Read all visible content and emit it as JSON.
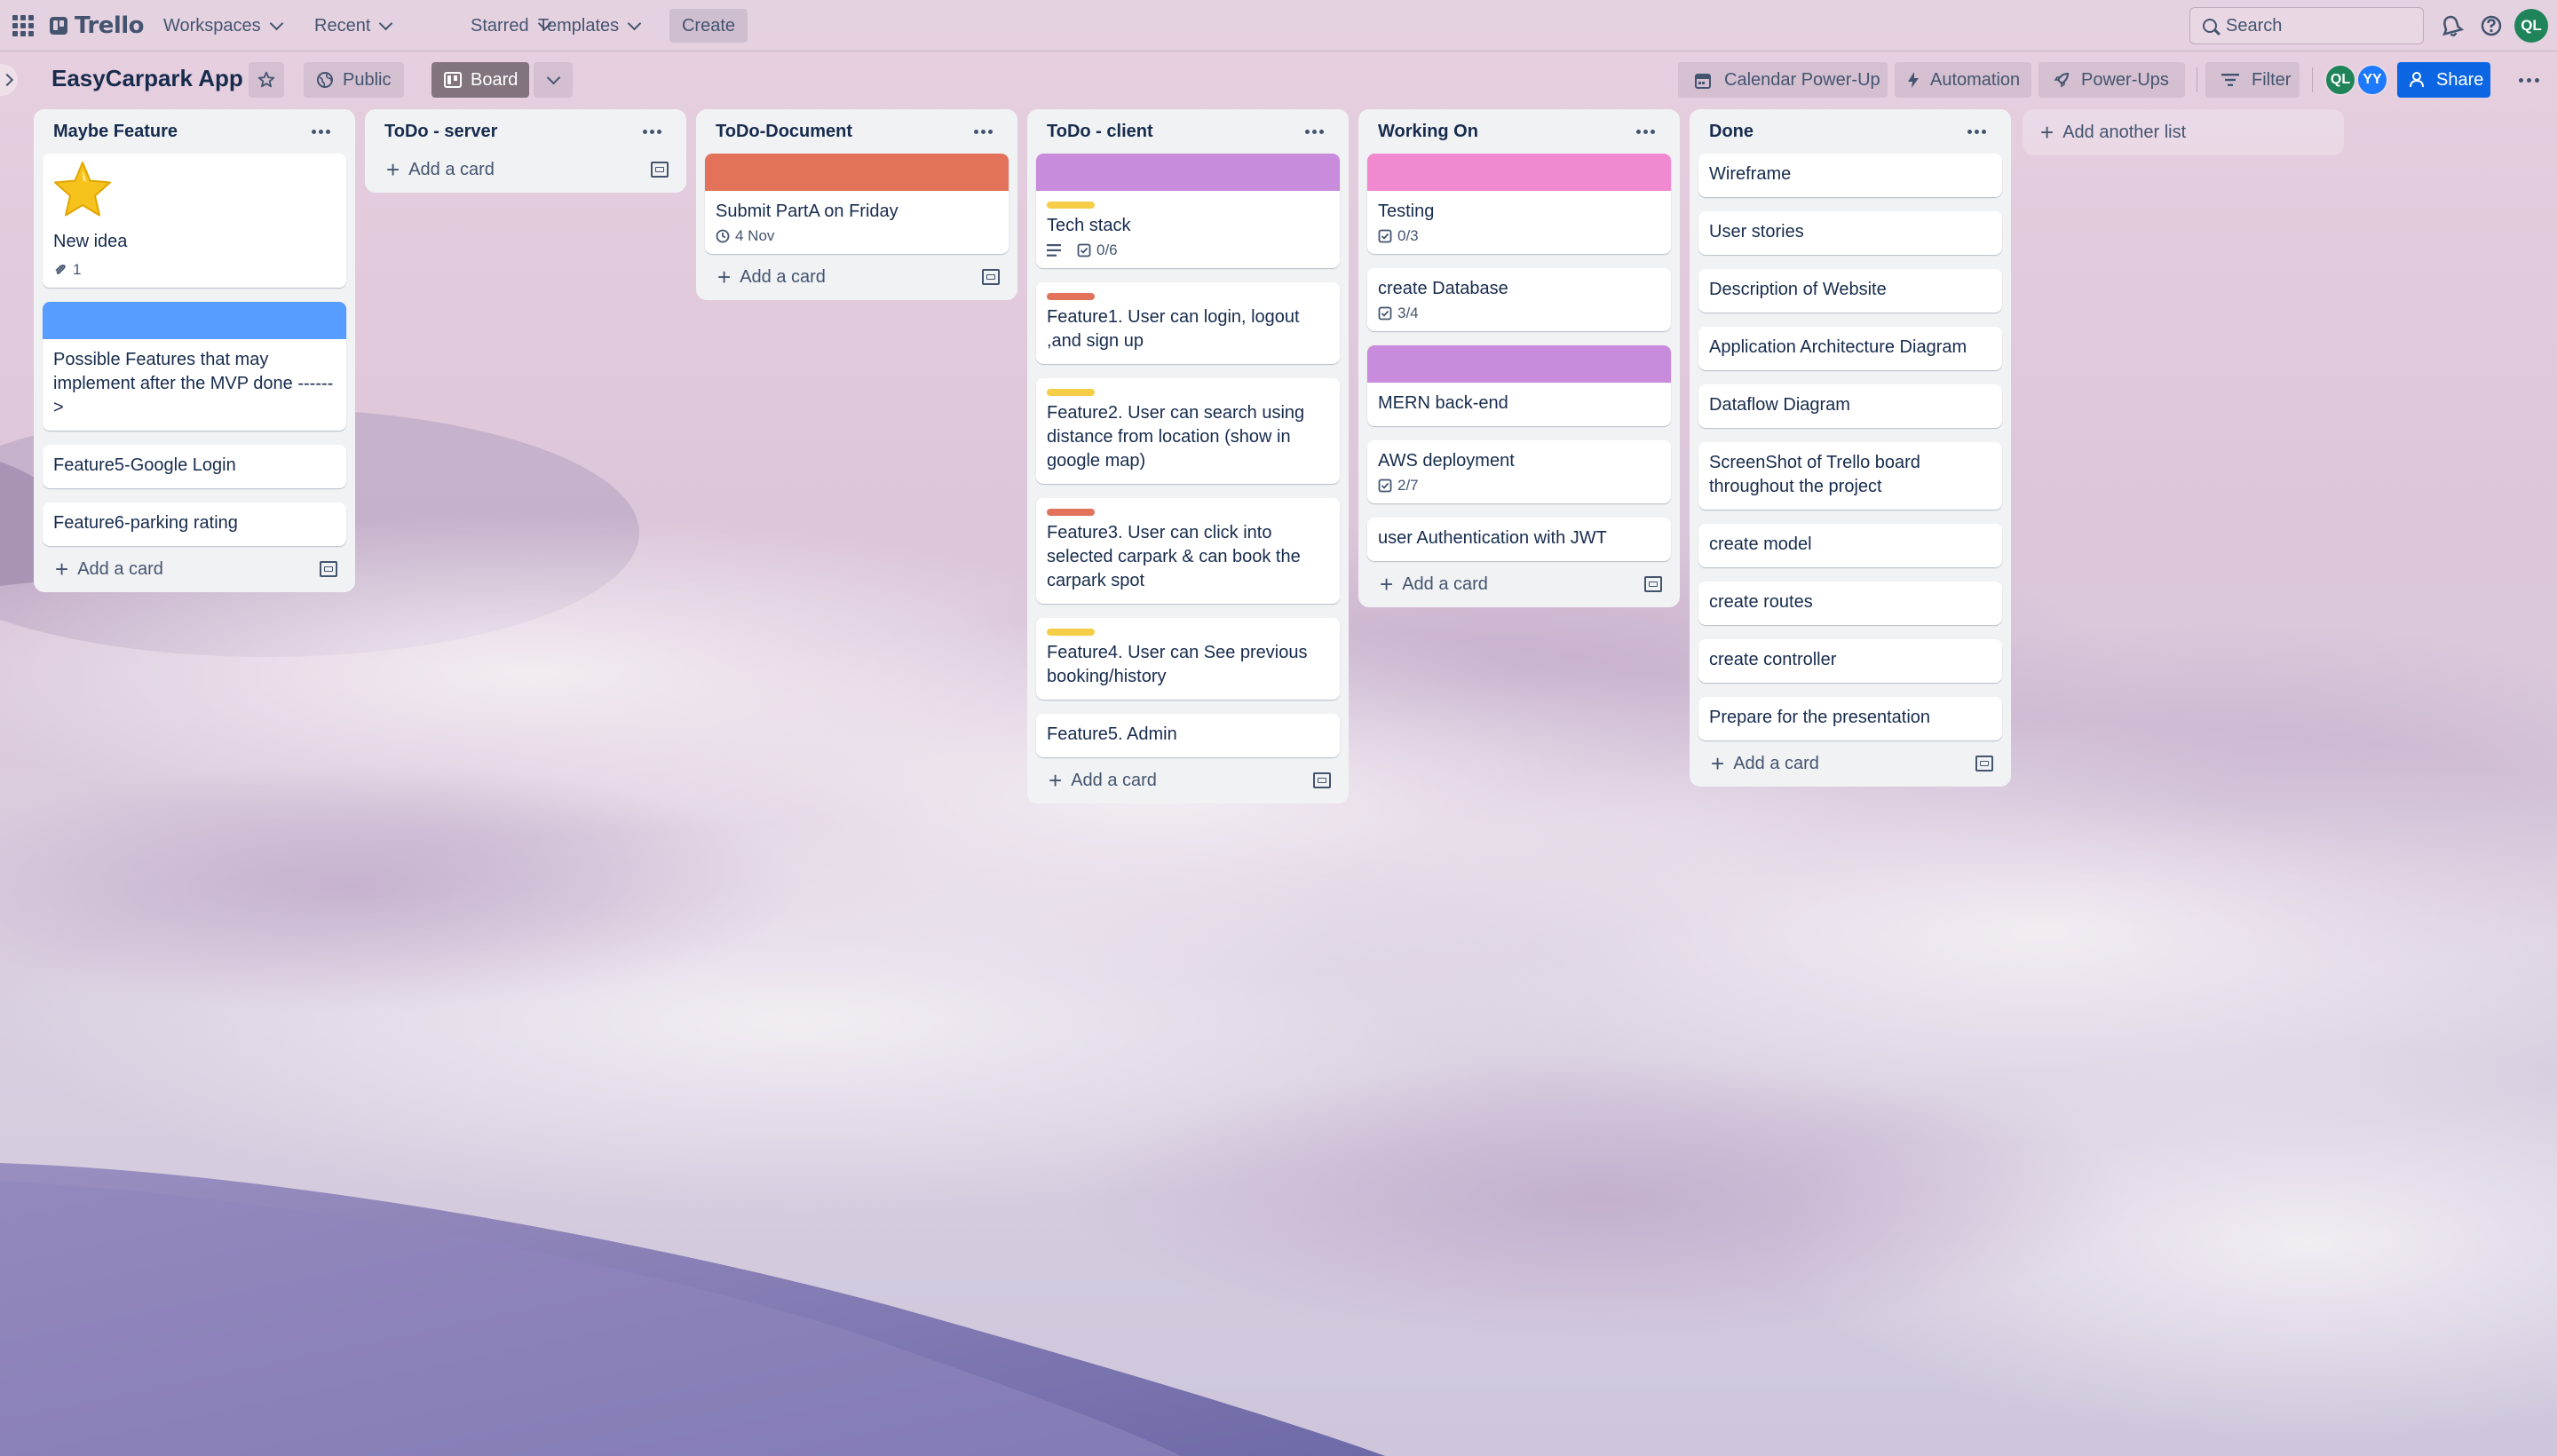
{
  "topbar": {
    "logo": "Trello",
    "nav": [
      "Workspaces",
      "Recent",
      "Starred",
      "Templates"
    ],
    "create": "Create",
    "search_placeholder": "Search",
    "user_initials": "QL"
  },
  "board": {
    "title": "EasyCarpark App",
    "visibility": "Public",
    "view": "Board",
    "calendar": "Calendar Power-Up",
    "automation": "Automation",
    "power_ups": "Power-Ups",
    "filter": "Filter",
    "members": [
      "QL",
      "YY"
    ],
    "share": "Share",
    "add_list": "Add another list"
  },
  "colors": {
    "green_avatar": "#1f845a",
    "blue_avatar": "#1d7afc",
    "share": "#0c66e4",
    "label_yellow": "#f5cd47",
    "label_red": "#e2735a",
    "cover_blue": "#579dff",
    "cover_orange": "#e2735a",
    "cover_purple": "#c98bdb",
    "cover_pink": "#f089d0"
  },
  "add_card": "Add a card",
  "lists": [
    {
      "title": "Maybe Feature",
      "cards": [
        {
          "title": "New idea",
          "cover": "star-sticker",
          "attachments": "1"
        },
        {
          "title": "Possible Features that may implement after the MVP done ------>",
          "cover": "#579dff"
        },
        {
          "title": "Feature5-Google Login"
        },
        {
          "title": "Feature6-parking rating"
        }
      ]
    },
    {
      "title": "ToDo - server",
      "cards": []
    },
    {
      "title": "ToDo-Document",
      "cards": [
        {
          "title": "Submit PartA on Friday",
          "cover": "#e2735a",
          "due": "4 Nov"
        }
      ]
    },
    {
      "title": "ToDo - client",
      "cards": [
        {
          "title": "Tech stack",
          "cover": "#c98bdb",
          "label": "#f5cd47",
          "description": true,
          "checklist": "0/6"
        },
        {
          "title": "Feature1. User can login, logout ,and sign up",
          "label": "#e2735a"
        },
        {
          "title": "Feature2. User can search using distance from location (show in google map)",
          "label": "#f5cd47"
        },
        {
          "title": "Feature3. User can click into selected carpark & can book the carpark spot",
          "label": "#e2735a"
        },
        {
          "title": "Feature4. User can See previous booking/history",
          "label": "#f5cd47"
        },
        {
          "title": "Feature5. Admin"
        }
      ]
    },
    {
      "title": "Working On",
      "cards": [
        {
          "title": "Testing",
          "cover": "#f089d0",
          "checklist": "0/3"
        },
        {
          "title": "create Database",
          "checklist": "3/4"
        },
        {
          "title": "MERN back-end",
          "cover": "#c98bdb"
        },
        {
          "title": "AWS deployment",
          "checklist": "2/7"
        },
        {
          "title": "user Authentication with JWT"
        }
      ]
    },
    {
      "title": "Done",
      "cards": [
        {
          "title": "Wireframe"
        },
        {
          "title": "User stories"
        },
        {
          "title": "Description of Website"
        },
        {
          "title": "Application Architecture Diagram"
        },
        {
          "title": "Dataflow Diagram"
        },
        {
          "title": "ScreenShot of Trello board throughout the project"
        },
        {
          "title": "create model"
        },
        {
          "title": "create routes"
        },
        {
          "title": "create controller"
        },
        {
          "title": "Prepare for the presentation"
        }
      ]
    }
  ]
}
